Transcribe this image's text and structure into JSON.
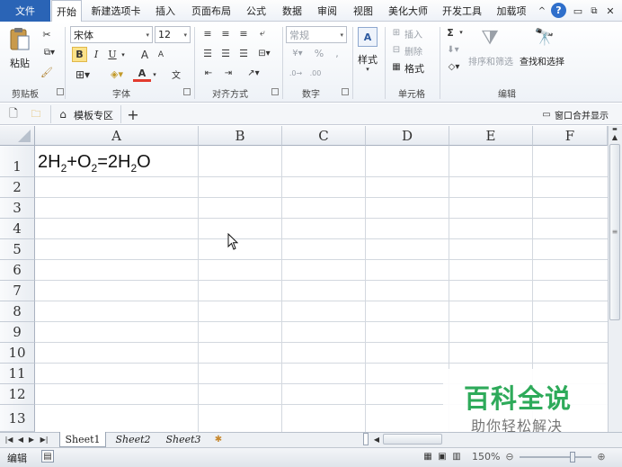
{
  "menu": {
    "file": "文件",
    "tabs": [
      "开始",
      "新建选项卡",
      "插入",
      "页面布局",
      "公式",
      "数据",
      "审阅",
      "视图",
      "美化大师",
      "开发工具",
      "加载项"
    ]
  },
  "ribbon": {
    "clipboard": {
      "paste": "粘贴",
      "group": "剪贴板"
    },
    "font": {
      "name": "宋体",
      "size": "12",
      "bold": "B",
      "italic": "I",
      "underline": "U",
      "grow": "A",
      "shrink": "A",
      "color_a": "A",
      "wen": "文",
      "group": "字体"
    },
    "align": {
      "group": "对齐方式"
    },
    "number": {
      "format": "常规",
      "percent": "%",
      "comma": ",",
      "group": "数字"
    },
    "styles": {
      "label": "样式"
    },
    "cells": {
      "insert": "插入",
      "delete": "删除",
      "format": "格式",
      "group": "单元格"
    },
    "editing": {
      "sum": "Σ",
      "sort": "排序和筛选",
      "find": "查找和选择",
      "group": "编辑"
    }
  },
  "tabstrip": {
    "template_zone": "模板专区",
    "add": "+",
    "merge": "窗口合并显示"
  },
  "grid": {
    "columns": [
      "A",
      "B",
      "C",
      "D",
      "E",
      "F"
    ],
    "rows": [
      "1",
      "2",
      "3",
      "4",
      "5",
      "6",
      "7",
      "8",
      "9",
      "10",
      "11",
      "12",
      "13"
    ],
    "a1": {
      "p1": "2H",
      "s1": "2",
      "p2": "+O",
      "s2": "2",
      "p3": "=2H",
      "s3": "2",
      "p4": "O"
    }
  },
  "sheets": [
    "Sheet1",
    "Sheet2",
    "Sheet3"
  ],
  "status": {
    "mode": "编辑",
    "zoom": "150%"
  },
  "watermark": {
    "title": "百科全说",
    "subtitle": "助你轻松解决"
  },
  "colors": {
    "file_tab": "#2a64b6",
    "watermark_title": "#2eaa5a"
  }
}
